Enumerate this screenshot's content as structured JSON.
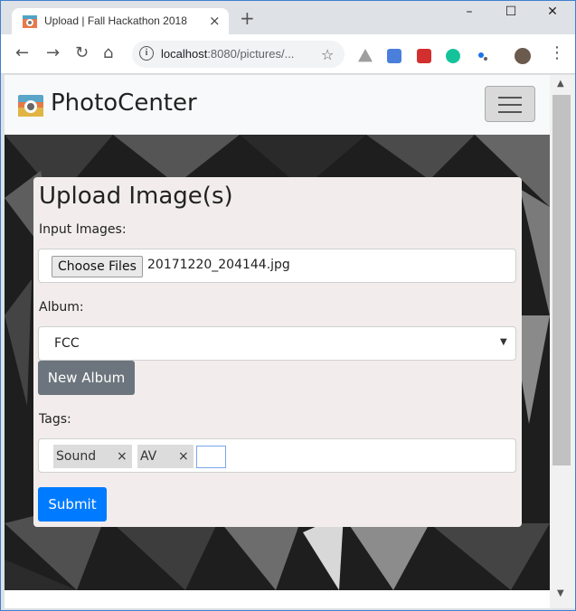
{
  "browser": {
    "tab_title": "Upload | Fall Hackathon 2018",
    "tab_close": "×",
    "new_tab": "+",
    "minimize": "–",
    "maximize": "☐",
    "close": "✕",
    "url_host": "localhost",
    "url_rest": ":8080/pictures/...",
    "back": "←",
    "forward": "→",
    "reload": "↻",
    "home": "⌂",
    "star": "☆",
    "menu": "⋮",
    "extension_icons": [
      "drive-icon",
      "translate-icon",
      "lastpass-icon",
      "grammarly-icon",
      "extension-icon",
      "profile-avatar"
    ]
  },
  "navbar": {
    "brand": "PhotoCenter"
  },
  "form": {
    "heading": "Upload Image(s)",
    "input_label": "Input Images:",
    "choose_files": "Choose Files",
    "file_name": "20171220_204144.jpg",
    "album_label": "Album:",
    "album_value": "FCC",
    "new_album": "New Album",
    "tags_label": "Tags:",
    "tags": [
      "Sound",
      "AV"
    ],
    "tag_remove": "×",
    "submit": "Submit"
  },
  "colors": {
    "primary": "#007bff",
    "secondary": "#6c757d",
    "card": "#f2ecec",
    "navbar": "#f8f9fa"
  }
}
